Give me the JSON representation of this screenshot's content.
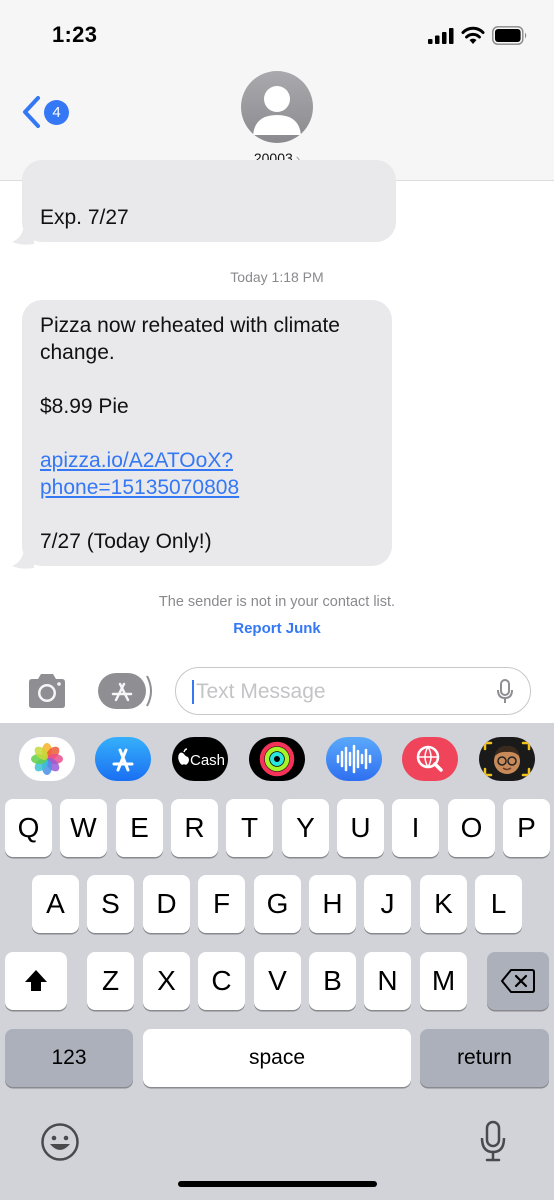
{
  "status_bar": {
    "time": "1:23"
  },
  "header": {
    "back_badge": "4",
    "contact_name": "20003",
    "contact_chevron": "›"
  },
  "messages": {
    "bubble1_text": "Exp. 7/27",
    "timestamp": "Today 1:18 PM",
    "bubble2": {
      "line1": "Pizza now reheated with climate change.",
      "line2": "$8.99 Pie",
      "link_line1": "apizza.io/A2ATOoX?",
      "link_line2": "phone=15135070808",
      "line4": "7/27 (Today Only!)"
    }
  },
  "notice": "The sender is not in your contact list.",
  "report_junk": "Report Junk",
  "input": {
    "placeholder": "Text Message"
  },
  "app_drawer": {
    "items": [
      "photos",
      "app-store",
      "apple-cash",
      "fitness",
      "audio-message",
      "images-search",
      "memoji"
    ],
    "cash_label": "Cash"
  },
  "keyboard": {
    "row1": [
      "Q",
      "W",
      "E",
      "R",
      "T",
      "Y",
      "U",
      "I",
      "O",
      "P"
    ],
    "row2": [
      "A",
      "S",
      "D",
      "F",
      "G",
      "H",
      "J",
      "K",
      "L"
    ],
    "row3": [
      "Z",
      "X",
      "C",
      "V",
      "B",
      "N",
      "M"
    ],
    "numbers_key": "123",
    "space_key": "space",
    "return_key": "return"
  },
  "colors": {
    "accent": "#3478f6",
    "bubble_gray": "#e9e9eb",
    "keyboard_bg": "#d1d3d9"
  }
}
